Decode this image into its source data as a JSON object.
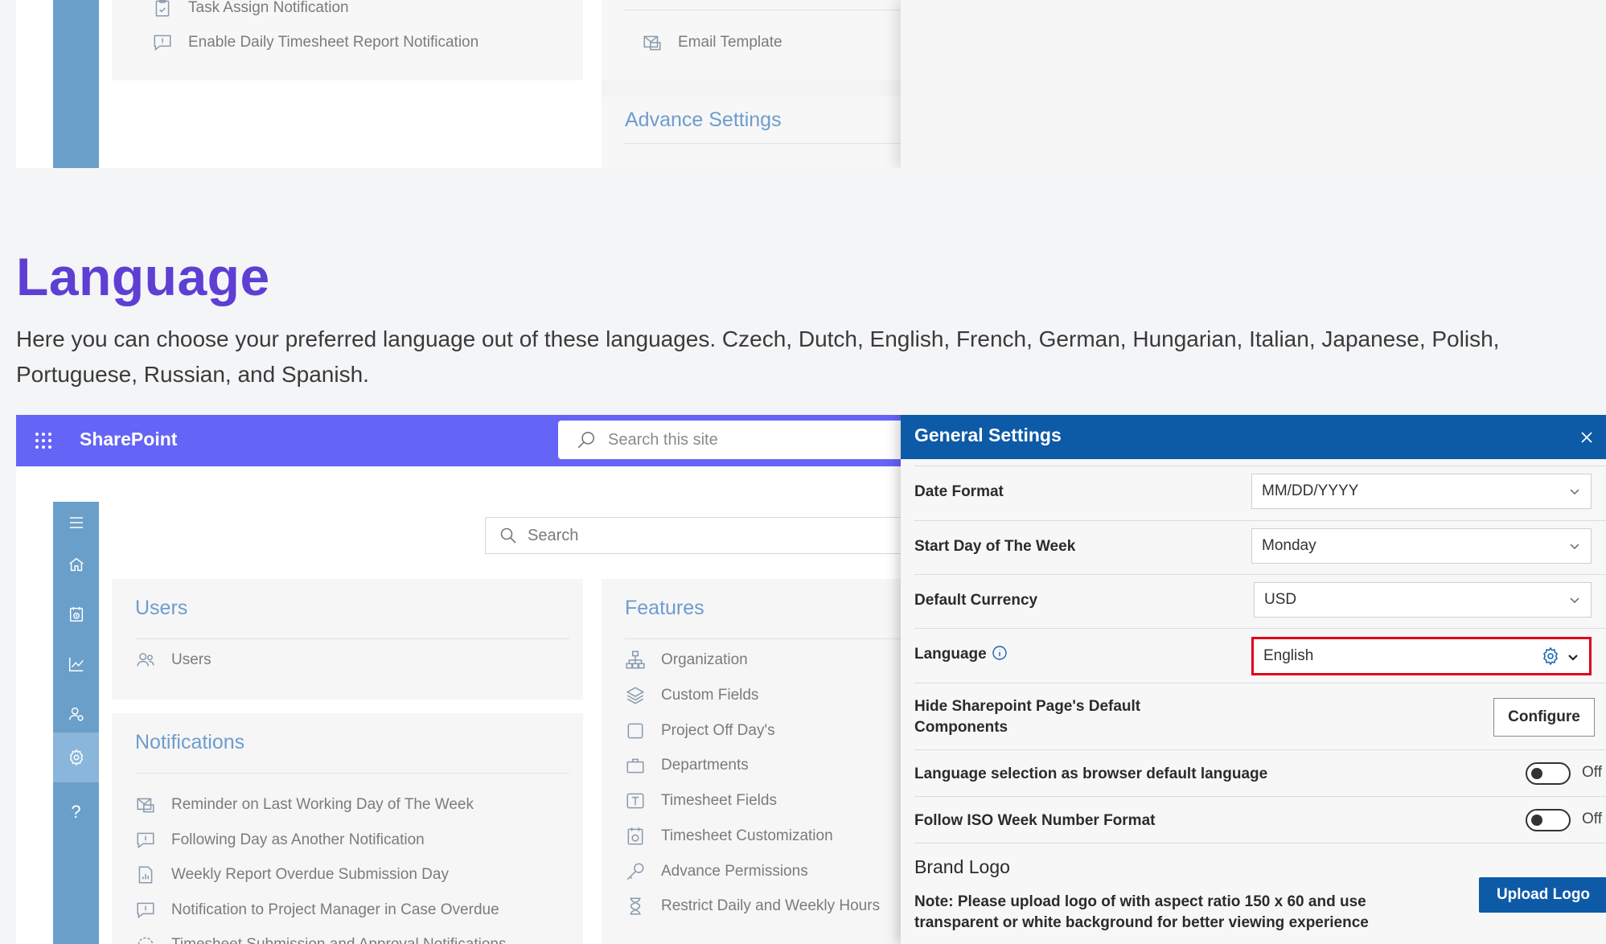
{
  "top_screenshot": {
    "notifications_items": [
      {
        "label": "Task Assign Notification",
        "icon": "clipboard-icon"
      },
      {
        "label": "Enable Daily Timesheet Report Notification",
        "icon": "comment-icon"
      }
    ],
    "features_items": [
      {
        "label": "Email Template",
        "icon": "email-template-icon"
      }
    ],
    "advance_settings_heading": "Advance Settings"
  },
  "section": {
    "title": "Language",
    "description": "Here you can choose your preferred language out of these languages. Czech, Dutch, English, French, German, Hungarian, Italian, Japanese, Polish, Portuguese, Russian, and Spanish."
  },
  "sharepoint": {
    "title": "SharePoint",
    "search_placeholder": "Search this site"
  },
  "app": {
    "search_placeholder": "Search",
    "users": {
      "heading": "Users",
      "items": [
        {
          "label": "Users",
          "icon": "users-icon"
        }
      ]
    },
    "notifications": {
      "heading": "Notifications",
      "items": [
        {
          "label": "Reminder on Last Working Day of The Week",
          "icon": "mail-reminder-icon"
        },
        {
          "label": "Following Day as Another Notification",
          "icon": "comment-icon"
        },
        {
          "label": "Weekly Report Overdue Submission Day",
          "icon": "report-icon"
        },
        {
          "label": "Notification to Project Manager in Case Overdue",
          "icon": "comment-icon"
        },
        {
          "label": "Timesheet Submission and Approval Notifications",
          "icon": "refresh-icon"
        }
      ]
    },
    "features": {
      "heading": "Features",
      "items": [
        {
          "label": "Organization",
          "icon": "org-chart-icon"
        },
        {
          "label": "Custom Fields",
          "icon": "layers-icon"
        },
        {
          "label": "Project Off Day's",
          "icon": "square-icon"
        },
        {
          "label": "Departments",
          "icon": "briefcase-icon"
        },
        {
          "label": "Timesheet Fields",
          "icon": "text-field-icon"
        },
        {
          "label": "Timesheet Customization",
          "icon": "timesheet-custom-icon"
        },
        {
          "label": "Advance Permissions",
          "icon": "key-icon"
        },
        {
          "label": "Restrict Daily and Weekly Hours",
          "icon": "hourglass-icon"
        }
      ]
    },
    "nav_icons": [
      "menu-icon",
      "home-icon",
      "timesheet-icon",
      "chart-icon",
      "user-settings-icon",
      "gear-icon",
      "help-icon"
    ],
    "nav_active": "gear-icon",
    "help_glyph": "?"
  },
  "settings_panel": {
    "title": "General Settings",
    "date_format": {
      "label": "Date Format",
      "value": "MM/DD/YYYY"
    },
    "start_day": {
      "label": "Start Day of The Week",
      "value": "Monday"
    },
    "currency": {
      "label": "Default Currency",
      "value": "USD"
    },
    "language": {
      "label": "Language",
      "value": "English"
    },
    "hide_components": {
      "label": "Hide Sharepoint Page's Default Components",
      "button": "Configure"
    },
    "browser_language": {
      "label": "Language selection as browser default language",
      "state": "Off"
    },
    "iso_week": {
      "label": "Follow ISO Week Number Format",
      "state": "Off"
    },
    "brand_logo": {
      "title": "Brand Logo",
      "note": "Note: Please upload logo of with aspect ratio 150 x 60 and use transparent or white background for better viewing experience",
      "button": "Upload Logo"
    }
  },
  "colors": {
    "sharepoint_bar": "#6464f7",
    "panel_header": "#0d5aa7",
    "nav_rail": "#6a9fca",
    "title_purple": "#5d3fd3",
    "highlight_red": "#e0001a"
  }
}
